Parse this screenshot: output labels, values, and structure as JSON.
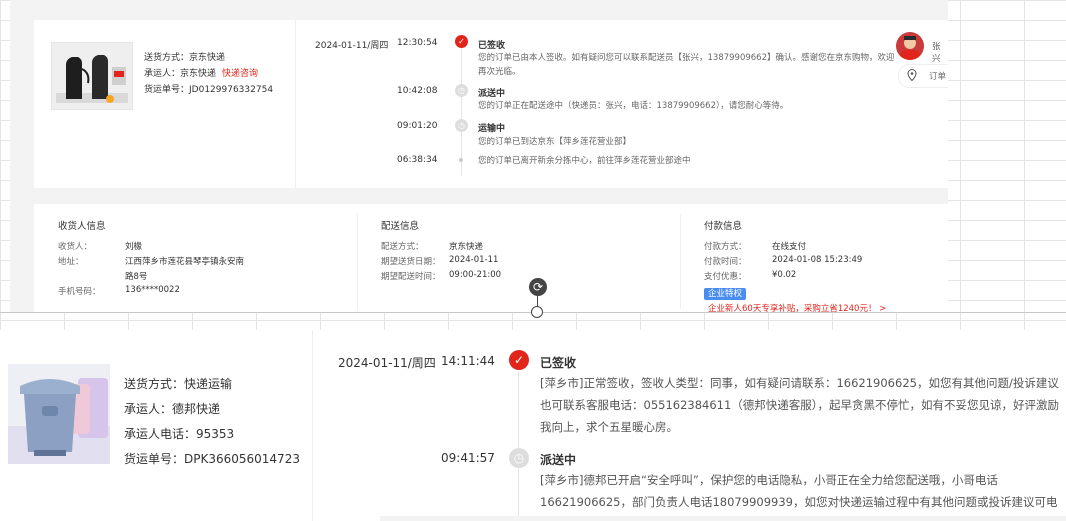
{
  "top": {
    "order": {
      "delivery_method_label": "送货方式：",
      "delivery_method": "京东快递",
      "carrier_label": "承运人：",
      "carrier": "京东快递",
      "carrier_link": "快递咨询",
      "tracking_label": "货运单号：",
      "tracking": "JD0129976332754"
    },
    "timeline": [
      {
        "date": "2024-01-11/周四",
        "time": "12:30:54",
        "status": "已签收",
        "desc": "您的订单已由本人签收。如有疑问您可以联系配送员【张兴，13879909662】确认。感谢您在京东购物，欢迎再次光临。"
      },
      {
        "date": "",
        "time": "10:42:08",
        "status": "派送中",
        "desc": "您的订单正在配送途中（快递员：张兴，电话：13879909662），请您耐心等待。"
      },
      {
        "date": "",
        "time": "09:01:20",
        "status": "运输中",
        "desc": "您的订单已到达京东【萍乡莲花营业部】"
      },
      {
        "date": "",
        "time": "06:38:34",
        "status": "",
        "desc": "您的订单已离开新余分拣中心，前往萍乡莲花营业部途中"
      }
    ],
    "side": {
      "name": "张兴",
      "locate": "订单"
    },
    "consignee": {
      "title": "收货人信息",
      "name_label": "收货人：",
      "name": "刘椽",
      "addr_label": "地址：",
      "addr_line1": "江西萍乡市莲花县琴亭镇永安南",
      "addr_line2": "路8号",
      "phone_label": "手机号码：",
      "phone": "136****0022"
    },
    "delivery": {
      "title": "配送信息",
      "method_label": "配送方式：",
      "method": "京东快递",
      "date_label": "期望送货日期：",
      "date": "2024-01-11",
      "time_label": "期望配送时间：",
      "time": "09:00-21:00"
    },
    "payment": {
      "title": "付款信息",
      "method_label": "付款方式：",
      "method": "在线支付",
      "time_label": "付款时间：",
      "time": "2024-01-08 15:23:49",
      "discount_label": "支付优惠：",
      "discount": "¥0.02",
      "badge": "企业特权",
      "promo": "企业新人60天专享补贴，采购立省1240元！ >"
    }
  },
  "bottom": {
    "order": {
      "delivery_method": "送货方式：快递运输",
      "carrier": "承运人：德邦快递",
      "carrier_phone": "承运人电话：95353",
      "tracking": "货运单号：DPK366056014723"
    },
    "timeline": [
      {
        "date": "2024-01-11/周四",
        "time": "14:11:44",
        "status": "已签收",
        "desc": "[萍乡市]正常签收，签收人类型：同事，如有疑问请联系：16621906625，如您有其他问题/投诉建议也可联系客服电话：055162384611（德邦快递客服），起早贪黑不停忙，如有不妥您见谅，好评激励我向上，求个五星暖心房。"
      },
      {
        "date": "",
        "time": "09:41:57",
        "status": "派送中",
        "desc": "[萍乡市]德邦已开启“安全呼叫”，保护您的电话隐私，小哥正在全力给您配送哦，小哥电话16621906625，部门负责人电话18079909939，如您对快递运输过程中有其他问题或投诉建议可电"
      }
    ]
  },
  "colors": {
    "accent_red": "#e1251b",
    "badge_blue": "#4a8cf0",
    "grid": "#e4e4e4"
  }
}
